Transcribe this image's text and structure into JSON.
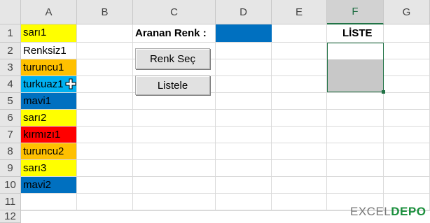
{
  "columns": [
    "A",
    "B",
    "C",
    "D",
    "E",
    "F",
    "G"
  ],
  "rows": [
    "1",
    "2",
    "3",
    "4",
    "5",
    "6",
    "7",
    "8",
    "9",
    "10",
    "11",
    "12"
  ],
  "selected_column": "F",
  "colors": {
    "sari": "#ffff00",
    "renksiz": "#ffffff",
    "turuncu": "#ffc000",
    "turkuaz": "#00b0f0",
    "mavi": "#0070c0",
    "kirmizi": "#ff0000",
    "selection": "#217346",
    "list_selected": "#c8c8c8"
  },
  "column_a": [
    {
      "text": "sarı1",
      "color": "#ffff00"
    },
    {
      "text": "Renksiz1",
      "color": "#ffffff"
    },
    {
      "text": "turuncu1",
      "color": "#ffc000"
    },
    {
      "text": "turkuaz1",
      "color": "#00b0f0"
    },
    {
      "text": "mavi1",
      "color": "#0070c0"
    },
    {
      "text": "sarı2",
      "color": "#ffff00"
    },
    {
      "text": "kırmızı1",
      "color": "#ff0000"
    },
    {
      "text": "turuncu2",
      "color": "#ffc000"
    },
    {
      "text": "sarı3",
      "color": "#ffff00"
    },
    {
      "text": "mavi2",
      "color": "#0070c0"
    }
  ],
  "search": {
    "label": "Aranan Renk :",
    "color": "#0070c0"
  },
  "list_header": "LİSTE",
  "buttons": {
    "pick_color": "Renk Seç",
    "list": "Listele"
  },
  "list_items": [
    "",
    "",
    ""
  ],
  "list_selected_rows": [
    1,
    2
  ],
  "cursor_icon": "move-cursor-icon",
  "watermark": {
    "part1": "EXCEL",
    "part2": "DEPO"
  }
}
